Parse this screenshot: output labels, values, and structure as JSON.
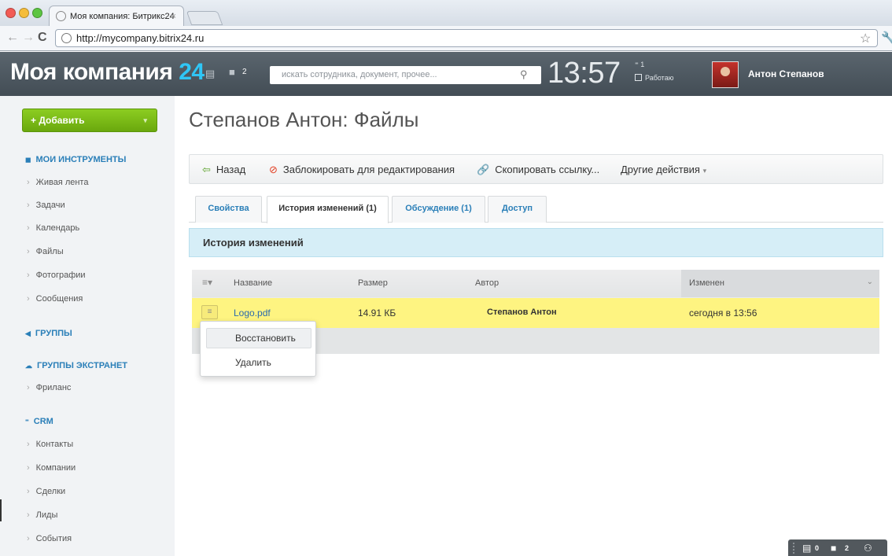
{
  "browser": {
    "tab_title": "Моя компания: Битрикс24",
    "tab_close": "×",
    "url": "http://mycompany.bitrix24.ru"
  },
  "header": {
    "logo_text": "Моя компания",
    "logo_num": "24",
    "notifications_count": "2",
    "search_placeholder": "искать сотрудника, документ, прочее...",
    "clock": "13:57",
    "timeman_count": "1",
    "timeman_status": "Работаю",
    "user_name": "Антон Степанов"
  },
  "sidebar": {
    "add_label": "+ Добавить",
    "sections": {
      "tools": "МОИ ИНСТРУМЕНТЫ",
      "groups": "ГРУППЫ",
      "extranet": "ГРУППЫ ЭКСТРАНЕТ",
      "crm": "CRM"
    },
    "tools_items": [
      "Живая лента",
      "Задачи",
      "Календарь",
      "Файлы",
      "Фотографии",
      "Сообщения"
    ],
    "extranet_items": [
      "Фриланс"
    ],
    "crm_items": [
      "Контакты",
      "Компании",
      "Сделки",
      "Лиды",
      "События"
    ]
  },
  "main": {
    "page_title": "Степанов Антон: Файлы",
    "toolbar": {
      "back": "Назад",
      "lock": "Заблокировать для редактирования",
      "copy_link": "Скопировать ссылку...",
      "more": "Другие действия"
    },
    "tabs": [
      "Свойства",
      "История изменений (1)",
      "Обсуждение (1)",
      "Доступ"
    ],
    "active_tab": "История изменений (1)",
    "panel_title": "История изменений",
    "grid": {
      "columns": [
        "Название",
        "Размер",
        "Автор",
        "Изменен"
      ],
      "rows": [
        {
          "name": "Logo.pdf",
          "size": "14.91 КБ",
          "author": "Степанов Антон",
          "changed": "сегодня в 13:56"
        }
      ]
    },
    "context_menu": [
      "Восстановить",
      "Удалить"
    ]
  },
  "statusbar": {
    "messages_count": "0",
    "notifications_count": "2"
  },
  "colors": {
    "accent_blue": "#2fc6f6",
    "link_blue": "#2a7fb8",
    "add_green": "#7bbd15",
    "row_highlight": "#fef481",
    "header_bg": "#4e5961"
  }
}
